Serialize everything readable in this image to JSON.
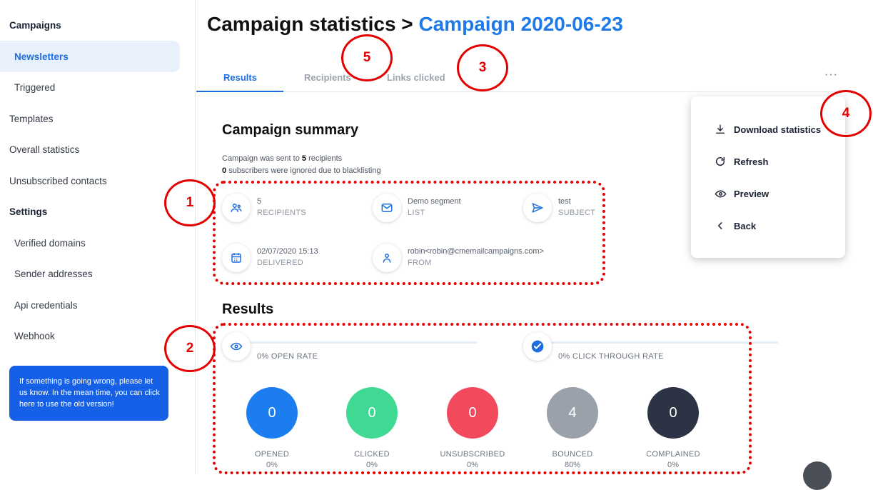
{
  "sidebar": {
    "items": [
      {
        "label": "Campaigns"
      },
      {
        "label": "Newsletters"
      },
      {
        "label": "Triggered"
      },
      {
        "label": "Templates"
      },
      {
        "label": "Overall statistics"
      },
      {
        "label": "Unsubscribed contacts"
      },
      {
        "label": "Settings"
      },
      {
        "label": "Verified domains"
      },
      {
        "label": "Sender addresses"
      },
      {
        "label": "Api credentials"
      },
      {
        "label": "Webhook"
      }
    ],
    "help_text": "If something is going wrong, please let us know. In the mean time, you can click here to use the old version!"
  },
  "header": {
    "title": "Campaign statistics >",
    "crumb": "Campaign 2020-06-23"
  },
  "tabs": [
    {
      "label": "Results"
    },
    {
      "label": "Recipients"
    },
    {
      "label": "Links clicked"
    }
  ],
  "more_button": "···",
  "summary": {
    "heading": "Campaign summary",
    "sent_prefix": "Campaign was sent to",
    "sent_count": "5",
    "sent_suffix": "recipients",
    "ignored_count": "0",
    "ignored_suffix": "subscribers were ignored due to blacklisting",
    "cards": [
      {
        "value": "5",
        "label": "RECIPIENTS",
        "icon": "people-icon"
      },
      {
        "value": "Demo segment",
        "label": "LIST",
        "icon": "envelope-icon"
      },
      {
        "value": "test",
        "label": "SUBJECT",
        "icon": "send-icon"
      },
      {
        "value": "02/07/2020 15:13",
        "label": "DELIVERED",
        "icon": "calendar-icon"
      },
      {
        "value": "robin<robin@cmemailcampaigns.com>",
        "label": "FROM",
        "icon": "person-icon"
      }
    ]
  },
  "results": {
    "heading": "Results",
    "open_rate": "0% OPEN RATE",
    "click_rate": "0% CLICK THROUGH RATE",
    "stats": [
      {
        "value": "0",
        "label": "OPENED",
        "pct": "0%",
        "color": "#1b7df0"
      },
      {
        "value": "0",
        "label": "CLICKED",
        "pct": "0%",
        "color": "#3fd994"
      },
      {
        "value": "0",
        "label": "UNSUBSCRIBED",
        "pct": "0%",
        "color": "#f24a5c"
      },
      {
        "value": "4",
        "label": "BOUNCED",
        "pct": "80%",
        "color": "#9aa1ab"
      },
      {
        "value": "0",
        "label": "COMPLAINED",
        "pct": "0%",
        "color": "#2b3344"
      }
    ]
  },
  "menu": {
    "items": [
      {
        "label": "Download statistics",
        "icon": "download-icon"
      },
      {
        "label": "Refresh",
        "icon": "refresh-icon"
      },
      {
        "label": "Preview",
        "icon": "eye-icon"
      },
      {
        "label": "Back",
        "icon": "chevron-left-icon"
      }
    ]
  },
  "annotations": {
    "markers": [
      "1",
      "2",
      "3",
      "4",
      "5"
    ],
    "color": "#e40000"
  },
  "colors": {
    "accent": "#1d6fe0",
    "help_box": "#1560e6"
  }
}
